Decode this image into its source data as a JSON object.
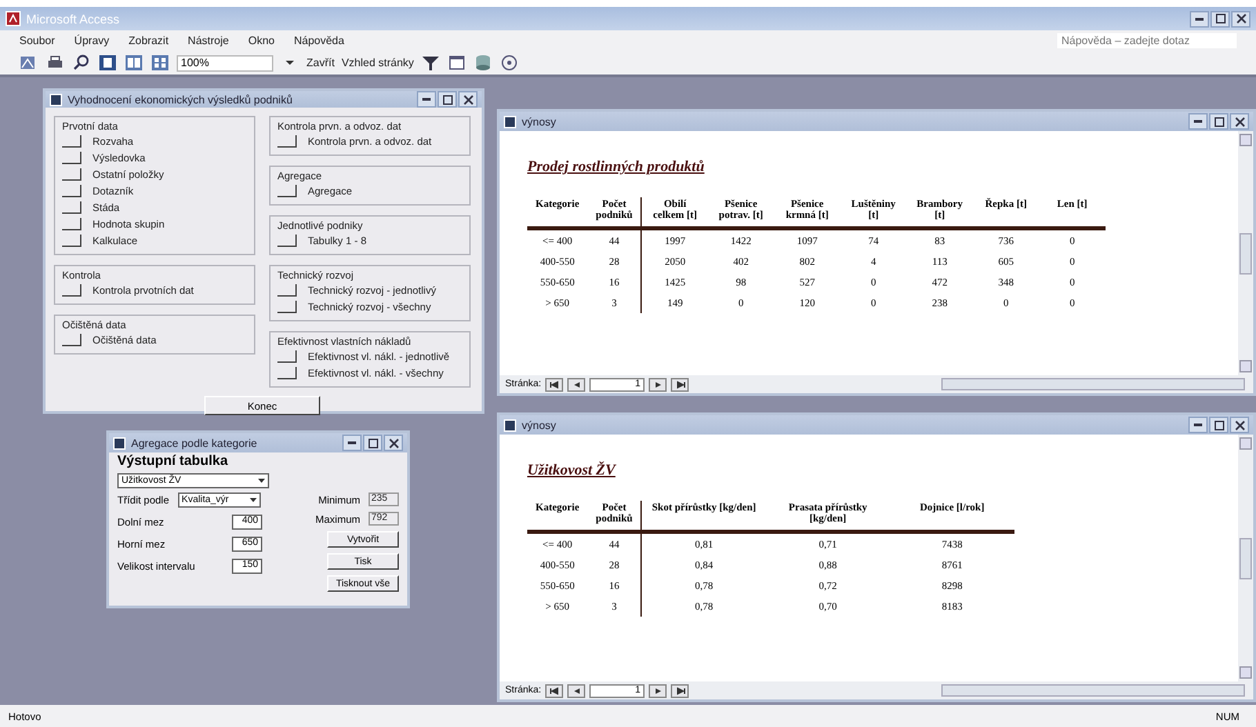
{
  "window": {
    "title": "Microsoft Access"
  },
  "menu": [
    "Soubor",
    "Úpravy",
    "Zobrazit",
    "Nástroje",
    "Okno",
    "Nápověda"
  ],
  "toolbar": {
    "zoom": "100%",
    "close_label": "Zavřít",
    "setup_label": "Vzhled stránky"
  },
  "help_box": {
    "placeholder": "Nápověda – zadejte dotaz"
  },
  "main_form": {
    "title": "Vyhodnocení ekonomických výsledků podniků",
    "left_groups": [
      {
        "title": "Prvotní data",
        "buttons": [
          "Rozvaha",
          "Výsledovka",
          "Ostatní položky",
          "Dotazník",
          "Stáda",
          "Hodnota skupin",
          "Kalkulace"
        ]
      },
      {
        "title": "Kontrola",
        "buttons": [
          "Kontrola prvotních dat"
        ]
      },
      {
        "title": "Očištěná data",
        "buttons": [
          "Očištěná data"
        ]
      }
    ],
    "right_groups": [
      {
        "title": "Kontrola prvn. a odvoz. dat",
        "buttons": [
          "Kontrola prvn. a odvoz. dat"
        ]
      },
      {
        "title": "Agregace",
        "buttons": [
          "Agregace"
        ]
      },
      {
        "title": "Jednotlivé podniky",
        "buttons": [
          "Tabulky 1 - 8"
        ]
      },
      {
        "title": "Technický rozvoj",
        "buttons": [
          "Technický rozvoj - jednotlivý",
          "Technický rozvoj - všechny"
        ]
      },
      {
        "title": "Efektivnost vlastních nákladů",
        "buttons": [
          "Efektivnost vl. nákl. - jednotlivě",
          "Efektivnost vl. nákl. - všechny"
        ]
      }
    ],
    "exit_button": "Konec"
  },
  "reports": [
    {
      "title": "výnosy",
      "heading": "Prodej rostlinných produktů",
      "page_label": "Stránka:",
      "page": "1",
      "columns": [
        "Kategorie",
        "Počet podniků",
        "Obilí celkem [t]",
        "Pšenice potrav. [t]",
        "Pšenice krmná [t]",
        "Luštěniny [t]",
        "Brambory [t]",
        "Řepka [t]",
        "Len [t]"
      ],
      "rows": [
        [
          "<= 400",
          "44",
          "1997",
          "1422",
          "1097",
          "74",
          "83",
          "736",
          "0"
        ],
        [
          "400-550",
          "28",
          "2050",
          "402",
          "802",
          "4",
          "113",
          "605",
          "0"
        ],
        [
          "550-650",
          "16",
          "1425",
          "98",
          "527",
          "0",
          "472",
          "348",
          "0"
        ],
        [
          "> 650",
          "3",
          "149",
          "0",
          "120",
          "0",
          "238",
          "0",
          "0"
        ]
      ]
    },
    {
      "title": "výnosy",
      "heading": "Užitkovost ŽV",
      "page_label": "Stránka:",
      "page": "1",
      "columns": [
        "Kategorie",
        "Počet podniků",
        "Skot přírůstky [kg/den]",
        "Prasata přírůstky [kg/den]",
        "Dojnice [l/rok]"
      ],
      "rows": [
        [
          "<= 400",
          "44",
          "0,81",
          "0,71",
          "7438"
        ],
        [
          "400-550",
          "28",
          "0,84",
          "0,88",
          "8761"
        ],
        [
          "550-650",
          "16",
          "0,78",
          "0,72",
          "8298"
        ],
        [
          "> 650",
          "3",
          "0,78",
          "0,70",
          "8183"
        ]
      ]
    }
  ],
  "dialog": {
    "title": "Agregace podle kategorie",
    "heading": "Výstupní tabulka",
    "table_select": "Užitkovost ŽV",
    "sort_label": "Třídit podle",
    "sort_select": "Kvalita_výr",
    "fields": [
      {
        "label": "Dolní mez",
        "value": "400"
      },
      {
        "label": "Horní mez",
        "value": "650"
      },
      {
        "label": "Velikost intervalu",
        "value": "150"
      }
    ],
    "stats": [
      {
        "label": "Minimum",
        "value": "235"
      },
      {
        "label": "Maximum",
        "value": "792"
      }
    ],
    "buttons": [
      "Vytvořit",
      "Tisk",
      "Tisknout vše"
    ]
  },
  "status_bar": {
    "text": "Hotovo",
    "mode": "NUM"
  }
}
